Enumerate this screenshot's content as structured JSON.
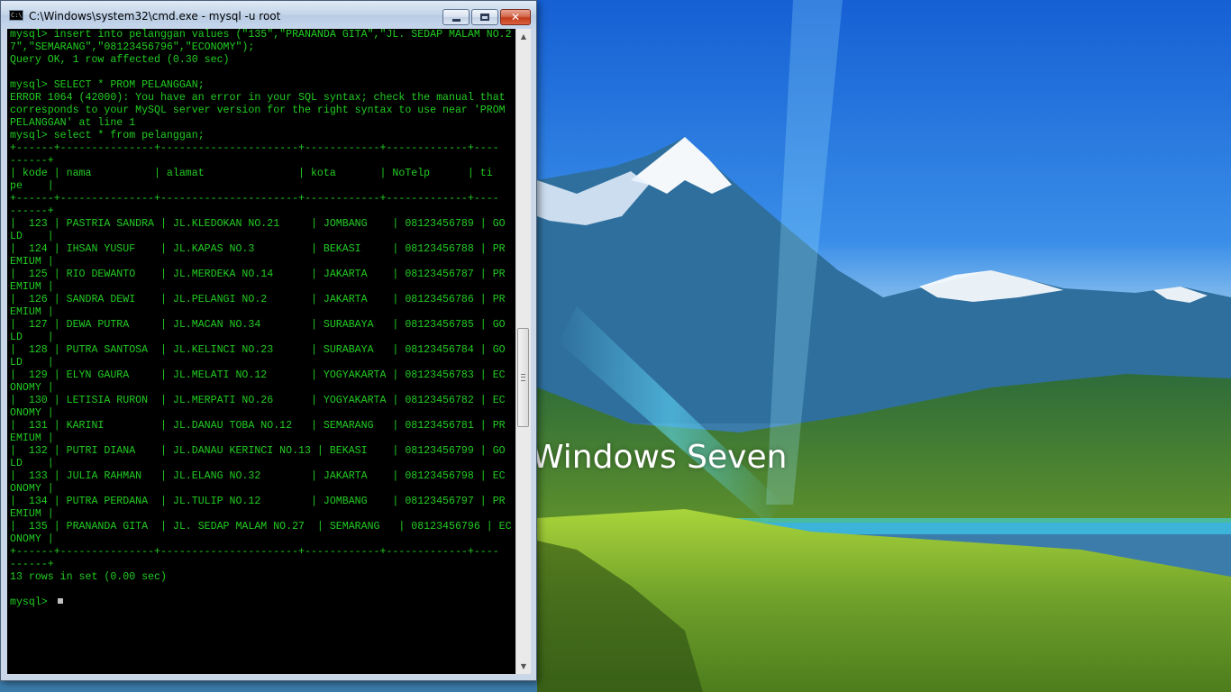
{
  "window": {
    "title": "C:\\Windows\\system32\\cmd.exe - mysql  -u root",
    "icon_text": "C:\\",
    "icon": "console-app-icon",
    "minimize_icon": "minimize-icon",
    "maximize_icon": "maximize-icon",
    "close_icon": "close-icon",
    "close_glyph": "✕"
  },
  "console": {
    "text_color": "#22cc22",
    "background": "#000000",
    "lines": [
      "mysql> insert into pelanggan values (\"135\",\"PRANANDA GITA\",\"JL. SEDAP MALAM NO.2",
      "7\",\"SEMARANG\",\"08123456796\",\"ECONOMY\");",
      "Query OK, 1 row affected (0.30 sec)",
      "",
      "mysql> SELECT * PROM PELANGGAN;",
      "ERROR 1064 (42000): You have an error in your SQL syntax; check the manual that",
      "corresponds to your MySQL server version for the right syntax to use near 'PROM",
      "PELANGGAN' at line 1",
      "mysql> select * from pelanggan;",
      "+------+---------------+----------------------+------------+-------------+----",
      "------+",
      "| kode | nama          | alamat               | kota       | NoTelp      | ti",
      "pe    |",
      "+------+---------------+----------------------+------------+-------------+----",
      "------+",
      "|  123 | PASTRIA SANDRA | JL.KLEDOKAN NO.21     | JOMBANG    | 08123456789 | GO",
      "LD    |",
      "|  124 | IHSAN YUSUF    | JL.KAPAS NO.3         | BEKASI     | 08123456788 | PR",
      "EMIUM |",
      "|  125 | RIO DEWANTO    | JL.MERDEKA NO.14      | JAKARTA    | 08123456787 | PR",
      "EMIUM |",
      "|  126 | SANDRA DEWI    | JL.PELANGI NO.2       | JAKARTA    | 08123456786 | PR",
      "EMIUM |",
      "|  127 | DEWA PUTRA     | JL.MACAN NO.34        | SURABAYA   | 08123456785 | GO",
      "LD    |",
      "|  128 | PUTRA SANTOSA  | JL.KELINCI NO.23      | SURABAYA   | 08123456784 | GO",
      "LD    |",
      "|  129 | ELYN GAURA     | JL.MELATI NO.12       | YOGYAKARTA | 08123456783 | EC",
      "ONOMY |",
      "|  130 | LETISIA RURON  | JL.MERPATI NO.26      | YOGYAKARTA | 08123456782 | EC",
      "ONOMY |",
      "|  131 | KARINI         | JL.DANAU TOBA NO.12   | SEMARANG   | 08123456781 | PR",
      "EMIUM |",
      "|  132 | PUTRI DIANA    | JL.DANAU KERINCI NO.13 | BEKASI    | 08123456799 | GO",
      "LD    |",
      "|  133 | JULIA RAHMAN   | JL.ELANG NO.32        | JAKARTA    | 08123456798 | EC",
      "ONOMY |",
      "|  134 | PUTRA PERDANA  | JL.TULIP NO.12        | JOMBANG    | 08123456797 | PR",
      "EMIUM |",
      "|  135 | PRANANDA GITA  | JL. SEDAP MALAM NO.27  | SEMARANG   | 08123456796 | EC",
      "ONOMY |",
      "+------+---------------+----------------------+------------+-------------+----",
      "------+",
      "13 rows in set (0.00 sec)",
      "",
      "mysql> "
    ]
  },
  "scrollbar": {
    "up_arrow": "▲",
    "down_arrow": "▼",
    "position": 0.55
  },
  "desktop": {
    "wallpaper_text": "Windows Seven"
  }
}
